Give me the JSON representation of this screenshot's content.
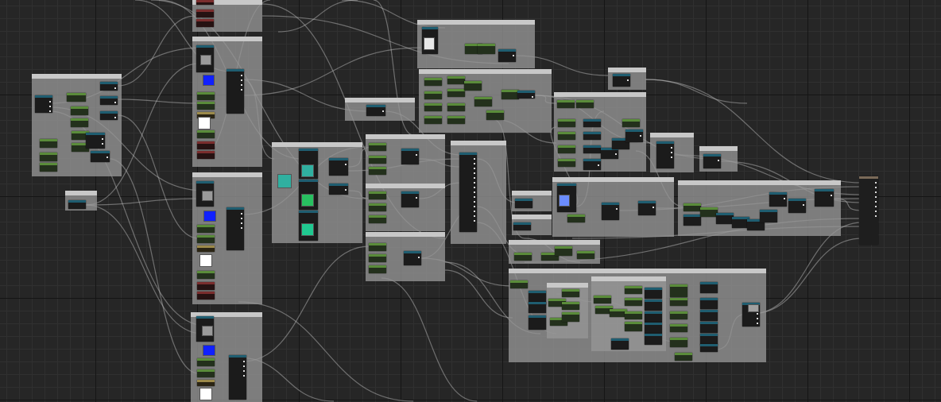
{
  "graph": {
    "comments": [
      {
        "title": ""
      },
      {
        "title": ""
      },
      {
        "title": ""
      },
      {
        "title": ""
      },
      {
        "title": ""
      },
      {
        "title": ""
      },
      {
        "title": ""
      },
      {
        "title": ""
      },
      {
        "title": ""
      },
      {
        "title": ""
      },
      {
        "title": ""
      },
      {
        "title": ""
      },
      {
        "title": ""
      },
      {
        "title": ""
      },
      {
        "title": ""
      },
      {
        "title": ""
      },
      {
        "title": ""
      },
      {
        "title": ""
      },
      {
        "title": ""
      },
      {
        "title": ""
      },
      {
        "title": ""
      },
      {
        "title": ""
      },
      {
        "title": ""
      },
      {
        "title": ""
      },
      {
        "title": ""
      },
      {
        "title": ""
      }
    ],
    "colors": {
      "background": "#262626",
      "comment_body": "#969696",
      "comment_header": "#c8c8c8",
      "function_node_header": "#1f5d70",
      "parameter_node_header": "#5a8c3a",
      "vector_node_header": "#7a2d2d",
      "texture_node_header": "#9c8a4a",
      "output_node_header": "#7a6a58",
      "wire": "#c8c8c8"
    },
    "swatch_colors": [
      "#e8e8e8",
      "#9a9a9a",
      "#1020ff",
      "#ffffff",
      "#30b0a0",
      "#28c060",
      "#20c890",
      "#6b8cff",
      "#a0a0a0"
    ]
  }
}
